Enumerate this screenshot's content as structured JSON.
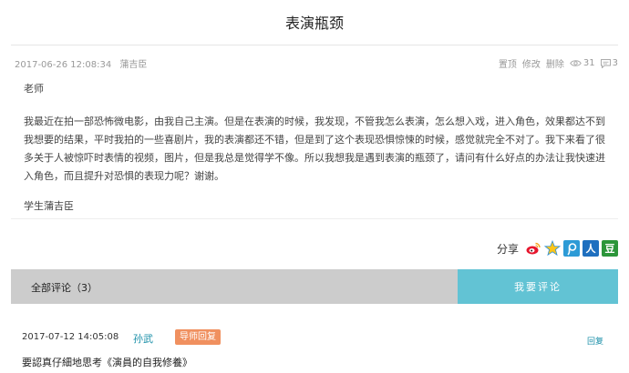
{
  "post": {
    "title": "表演瓶颈",
    "date": "2017-06-26 12:08:34",
    "author": "蒲吉臣",
    "actions": {
      "pin": "置顶",
      "edit": "修改",
      "delete": "删除"
    },
    "views": "31",
    "comments": "3",
    "greeting": "老师",
    "body": "我最近在拍一部恐怖微电影，由我自己主演。但是在表演的时候，我发现，不管我怎么表演，怎么想入戏，进入角色，效果都达不到我想要的结果，平时我拍的一些喜剧片，我的表演都还不错，但是到了这个表现恐惧惊悚的时候，感觉就完全不对了。我下来看了很多关于人被惊吓时表情的视频，图片，但是我总是觉得学不像。所以我想我是遇到表演的瓶颈了，请问有什么好点的办法让我快速进入角色，而且提升对恐惧的表现力呢？谢谢。",
    "signature": "学生蒲吉臣"
  },
  "share": {
    "label": "分享",
    "icons": [
      "weibo-icon",
      "qzone-icon",
      "tencent-weibo-icon",
      "renren-icon",
      "douban-icon"
    ],
    "renren_glyph": "人",
    "douban_glyph": "豆"
  },
  "comments_section": {
    "count_label": "全部评论（3）",
    "write_button": "我要评论"
  },
  "comment": {
    "date": "2017-07-12 14:05:08",
    "user": "孙武",
    "badge": "导师回复",
    "reply": "回复",
    "text": "要認真仔細地思考《演員的自我修養》"
  },
  "colors": {
    "accent": "#62c3d4",
    "badge": "#f0905f",
    "link": "#1a8fa8",
    "bar": "#cccccc"
  }
}
